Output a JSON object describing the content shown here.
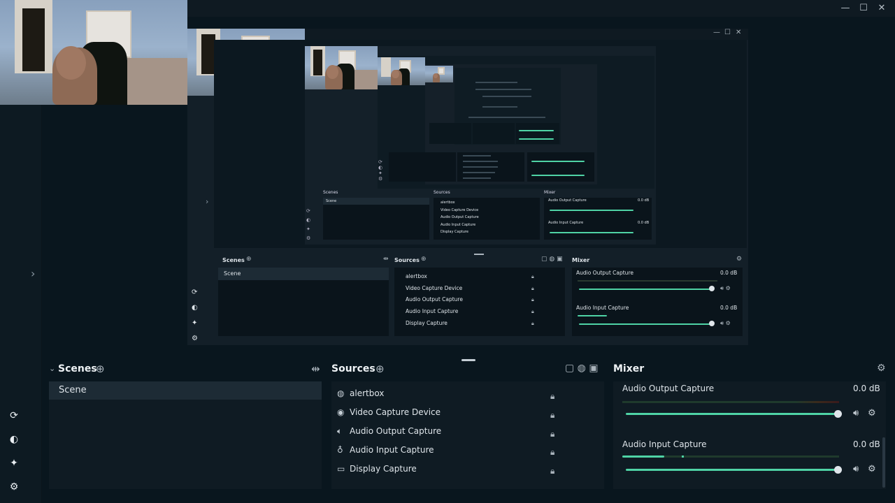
{
  "window": {
    "controls": [
      "—",
      "☐",
      "✕"
    ]
  },
  "nav": {
    "collapse_glyph": "›"
  },
  "main": {
    "scenes": {
      "title": "Scenes",
      "items": [
        "Scene"
      ]
    },
    "sources": {
      "title": "Sources",
      "items": [
        {
          "label": "alertbox",
          "icon": "globe-icon"
        },
        {
          "label": "Video Capture Device",
          "icon": "camera-icon"
        },
        {
          "label": "Audio Output Capture",
          "icon": "speaker-icon"
        },
        {
          "label": "Audio Input Capture",
          "icon": "mic-icon"
        },
        {
          "label": "Display Capture",
          "icon": "monitor-icon"
        }
      ]
    },
    "mixer": {
      "title": "Mixer",
      "channels": [
        {
          "name": "Audio Output Capture",
          "level": "0.0 dB"
        },
        {
          "name": "Audio Input Capture",
          "level": "0.0 dB"
        }
      ]
    }
  },
  "nested": {
    "scenes": {
      "title": "Scenes",
      "items": [
        "Scene"
      ]
    },
    "sources": {
      "title": "Sources",
      "items": [
        "alertbox",
        "Video Capture Device",
        "Audio Output Capture",
        "Audio Input Capture",
        "Display Capture"
      ]
    },
    "mixer": {
      "title": "Mixer",
      "channels": [
        {
          "name": "Audio Output Capture",
          "level": "0.0 dB"
        },
        {
          "name": "Audio Input Capture",
          "level": "0.0 dB"
        }
      ]
    }
  },
  "nested2": {
    "scenes": {
      "title": "Scenes",
      "items": [
        "Scene"
      ]
    },
    "sources": {
      "title": "Sources",
      "items": [
        "alertbox",
        "Video Capture Device",
        "Audio Output Capture",
        "Audio Input Capture",
        "Display Capture"
      ]
    },
    "mixer": {
      "title": "Mixer",
      "channels": [
        {
          "name": "Audio Output Capture",
          "level": "0.0 dB"
        },
        {
          "name": "Audio Input Capture",
          "level": "0.0 dB"
        }
      ]
    }
  },
  "colors": {
    "accent": "#4fd3a5",
    "bg": "#09161e",
    "panel": "#0f1b23"
  }
}
